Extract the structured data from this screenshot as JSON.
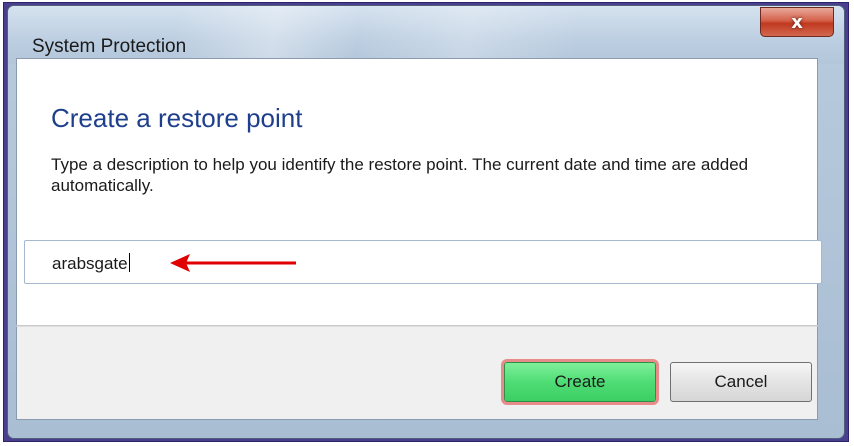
{
  "window": {
    "title": "System Protection",
    "close_label": "x"
  },
  "content": {
    "heading": "Create a restore point",
    "description": "Type a description to help you identify the restore point. The current date and time are added automatically.",
    "input_value": "arabsgate"
  },
  "buttons": {
    "create_label": "Create",
    "cancel_label": "Cancel"
  },
  "colors": {
    "heading": "#1e3f8c",
    "create_button": "#4fdc76",
    "arrow": "#e00000",
    "outer_frame": "#4a3f8f"
  },
  "icons": {
    "annotation": "red-arrow-icon",
    "close": "close-icon"
  }
}
